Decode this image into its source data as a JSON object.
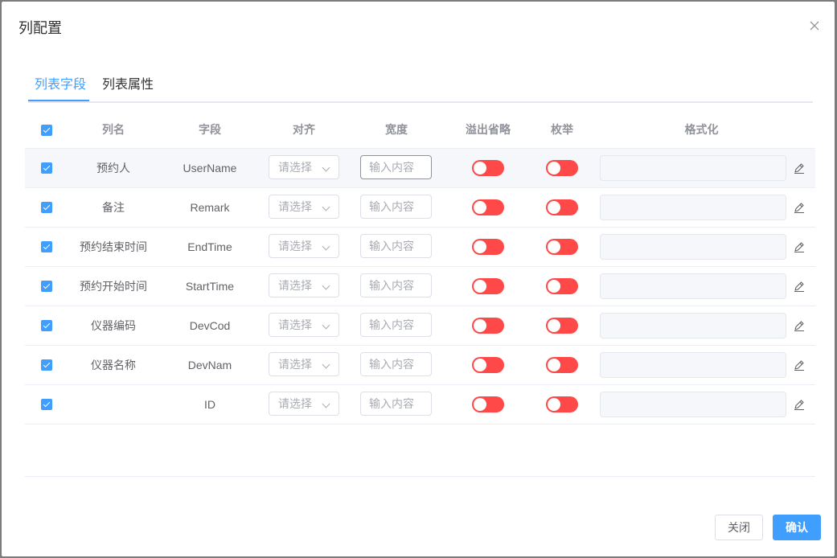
{
  "dialog": {
    "title": "列配置",
    "close_icon": "close-icon"
  },
  "tabs": [
    {
      "label": "列表字段",
      "active": true
    },
    {
      "label": "列表属性",
      "active": false
    }
  ],
  "columns": {
    "name": "列名",
    "field": "字段",
    "align": "对齐",
    "width": "宽度",
    "overflow": "溢出省略",
    "enum": "枚举",
    "format": "格式化"
  },
  "rows": [
    {
      "checked": true,
      "name": "预约人",
      "field": "UserName",
      "align_placeholder": "请选择",
      "width_placeholder": "输入内容",
      "overflow_on": false,
      "enum_on": false
    },
    {
      "checked": true,
      "name": "备注",
      "field": "Remark",
      "align_placeholder": "请选择",
      "width_placeholder": "输入内容",
      "overflow_on": false,
      "enum_on": false
    },
    {
      "checked": true,
      "name": "预约结束时间",
      "field": "EndTime",
      "align_placeholder": "请选择",
      "width_placeholder": "输入内容",
      "overflow_on": false,
      "enum_on": false
    },
    {
      "checked": true,
      "name": "预约开始时间",
      "field": "StartTime",
      "align_placeholder": "请选择",
      "width_placeholder": "输入内容",
      "overflow_on": false,
      "enum_on": false
    },
    {
      "checked": true,
      "name": "仪器编码",
      "field": "DevCod",
      "align_placeholder": "请选择",
      "width_placeholder": "输入内容",
      "overflow_on": false,
      "enum_on": false
    },
    {
      "checked": true,
      "name": "仪器名称",
      "field": "DevNam",
      "align_placeholder": "请选择",
      "width_placeholder": "输入内容",
      "overflow_on": false,
      "enum_on": false
    },
    {
      "checked": true,
      "name": "",
      "field": "ID",
      "align_placeholder": "请选择",
      "width_placeholder": "输入内容",
      "overflow_on": false,
      "enum_on": false
    }
  ],
  "footer": {
    "close_label": "关闭",
    "confirm_label": "确认"
  },
  "colors": {
    "primary": "#409eff",
    "switch_off": "#ff4949"
  },
  "icons": {
    "chevron": "chevron-down-icon",
    "edit": "edit-icon"
  }
}
